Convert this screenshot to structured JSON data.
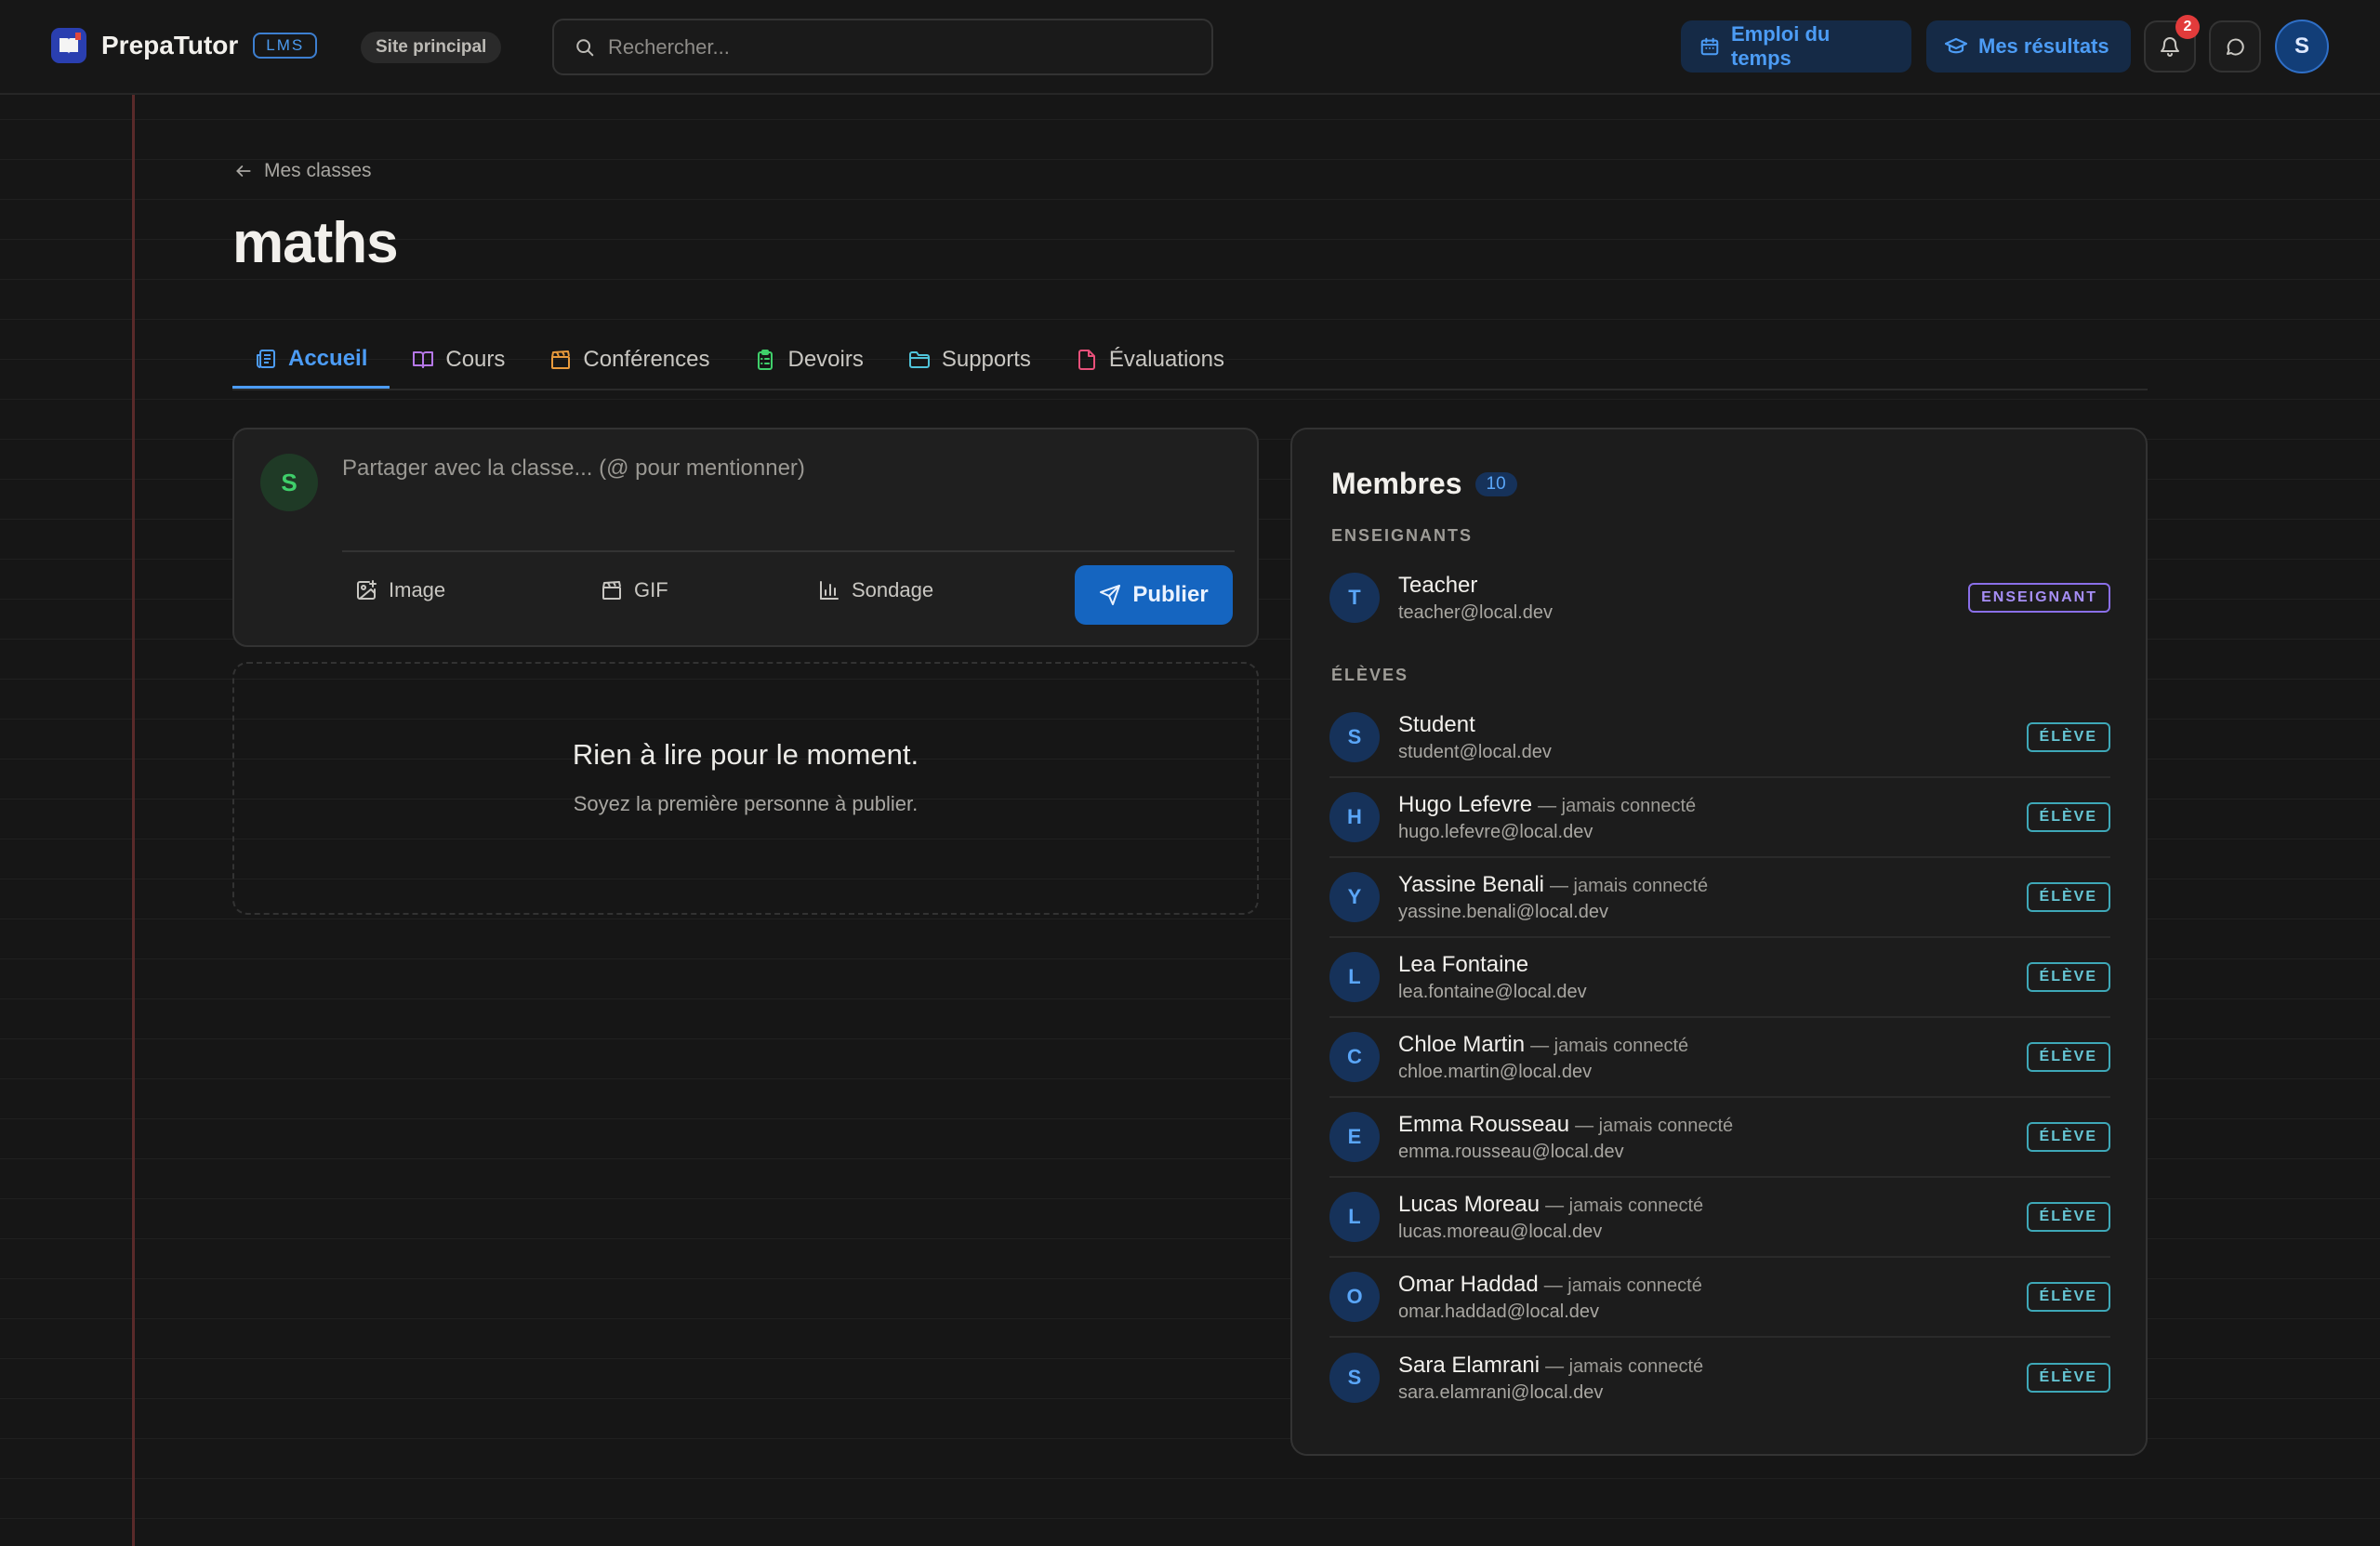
{
  "header": {
    "brand": "PrepaTutor",
    "brand_tag": "LMS",
    "site_link": "Site principal",
    "search_placeholder": "Rechercher...",
    "schedule_button": "Emploi du temps",
    "results_button": "Mes résultats",
    "notification_count": "2",
    "user_initial": "S"
  },
  "breadcrumb": {
    "back_label": "Mes classes"
  },
  "page": {
    "title": "maths"
  },
  "tabs": [
    {
      "label": "Accueil",
      "icon": "newspaper-icon",
      "active": true
    },
    {
      "label": "Cours",
      "icon": "book-icon"
    },
    {
      "label": "Conférences",
      "icon": "clapperboard-icon"
    },
    {
      "label": "Devoirs",
      "icon": "clipboard-list-icon"
    },
    {
      "label": "Supports",
      "icon": "folder-icon"
    },
    {
      "label": "Évaluations",
      "icon": "file-check-icon"
    }
  ],
  "composer": {
    "avatar_initial": "S",
    "placeholder": "Partager avec la classe... (@ pour mentionner)",
    "image_label": "Image",
    "gif_label": "GIF",
    "poll_label": "Sondage",
    "publish_label": "Publier"
  },
  "feed_empty": {
    "title": "Rien à lire pour le moment.",
    "subtitle": "Soyez la première personne à publier."
  },
  "members": {
    "title": "Membres",
    "count": "10",
    "teachers_label": "ENSEIGNANTS",
    "students_label": "ÉLÈVES",
    "teachers": [
      {
        "initial": "T",
        "name": "Teacher",
        "status": "",
        "email": "teacher@local.dev",
        "role": "ENSEIGNANT"
      }
    ],
    "students": [
      {
        "initial": "S",
        "name": "Student",
        "status": "",
        "email": "student@local.dev",
        "role": "ÉLÈVE"
      },
      {
        "initial": "H",
        "name": "Hugo Lefevre",
        "status": "— jamais connecté",
        "email": "hugo.lefevre@local.dev",
        "role": "ÉLÈVE"
      },
      {
        "initial": "Y",
        "name": "Yassine Benali",
        "status": "— jamais connecté",
        "email": "yassine.benali@local.dev",
        "role": "ÉLÈVE"
      },
      {
        "initial": "L",
        "name": "Lea Fontaine",
        "status": "",
        "email": "lea.fontaine@local.dev",
        "role": "ÉLÈVE"
      },
      {
        "initial": "C",
        "name": "Chloe Martin",
        "status": "— jamais connecté",
        "email": "chloe.martin@local.dev",
        "role": "ÉLÈVE"
      },
      {
        "initial": "E",
        "name": "Emma Rousseau",
        "status": "— jamais connecté",
        "email": "emma.rousseau@local.dev",
        "role": "ÉLÈVE"
      },
      {
        "initial": "L",
        "name": "Lucas Moreau",
        "status": "— jamais connecté",
        "email": "lucas.moreau@local.dev",
        "role": "ÉLÈVE"
      },
      {
        "initial": "O",
        "name": "Omar Haddad",
        "status": "— jamais connecté",
        "email": "omar.haddad@local.dev",
        "role": "ÉLÈVE"
      },
      {
        "initial": "S",
        "name": "Sara Elamrani",
        "status": "— jamais connecté",
        "email": "sara.elamrani@local.dev",
        "role": "ÉLÈVE"
      }
    ]
  },
  "colors": {
    "accent": "#4c9cf5",
    "primary_button": "#1565c0",
    "teacher_badge": "#8a6fe8",
    "student_badge": "#3ea8b8",
    "notification": "#e23b3b"
  }
}
